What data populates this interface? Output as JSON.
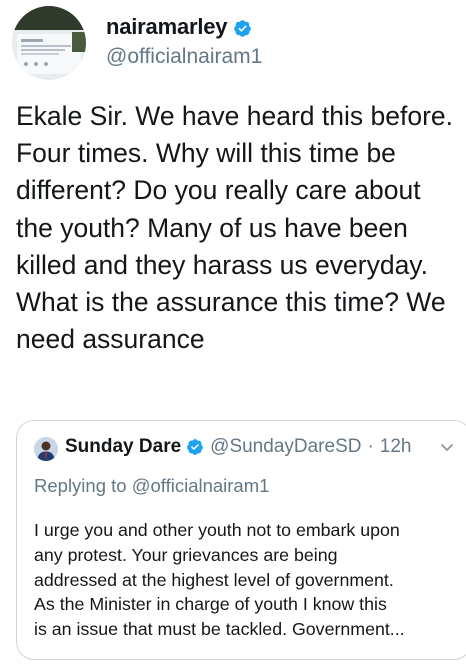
{
  "author": {
    "display_name": "nairamarley",
    "handle": "@officialnairam1",
    "verified_icon": "verified-badge-icon",
    "avatar_icon": "avatar-image"
  },
  "tweet": {
    "text": "Ekale Sir. We have heard this before. Four times. Why will this time be different? Do you really care about the youth? Many of us have been killed and they harass us everyday. What is the assurance this time? We need assurance"
  },
  "quote": {
    "display_name": "Sunday Dare",
    "handle": "@SundayDareSD",
    "separator": "·",
    "time": "12h",
    "replying_label": "Replying to",
    "replying_to": "@officialnairam1",
    "body_lines": [
      "I urge you and other youth not to embark upon",
      "any protest. Your  grievances are being",
      "addressed at the highest level of government.",
      "As the Minister in charge of youth I know this",
      "is an issue that must be tackled. Government..."
    ]
  },
  "colors": {
    "verified_blue": "#1da1f2",
    "secondary_text": "#657786",
    "primary_text": "#14171a",
    "border": "#ccd6dd"
  }
}
